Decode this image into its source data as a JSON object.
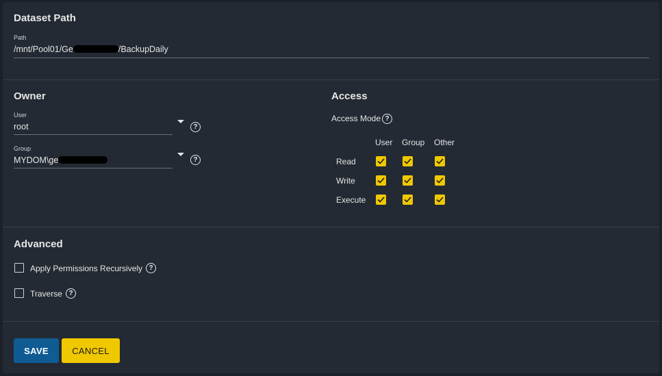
{
  "dataset": {
    "title": "Dataset Path",
    "path_label": "Path",
    "path_prefix": "/mnt/Pool01/Ge",
    "path_suffix": "/BackupDaily"
  },
  "owner": {
    "title": "Owner",
    "user_label": "User",
    "user_value": "root",
    "group_label": "Group",
    "group_value": "MYDOM\\ge"
  },
  "access": {
    "title": "Access",
    "mode_label": "Access Mode",
    "columns": [
      "User",
      "Group",
      "Other"
    ],
    "rows": [
      {
        "label": "Read",
        "user": true,
        "group": true,
        "other": true
      },
      {
        "label": "Write",
        "user": true,
        "group": true,
        "other": true
      },
      {
        "label": "Execute",
        "user": true,
        "group": true,
        "other": true
      }
    ]
  },
  "advanced": {
    "title": "Advanced",
    "recursive_label": "Apply Permissions Recursively",
    "recursive_checked": false,
    "traverse_label": "Traverse",
    "traverse_checked": false
  },
  "actions": {
    "save_label": "SAVE",
    "cancel_label": "CANCEL"
  },
  "colors": {
    "accent_yellow": "#f0c800",
    "primary_blue": "#0f5b94",
    "card_bg": "#232a33"
  },
  "icons": {
    "help": "help-circle-icon",
    "dropdown": "caret-down-icon",
    "check": "check-icon"
  }
}
